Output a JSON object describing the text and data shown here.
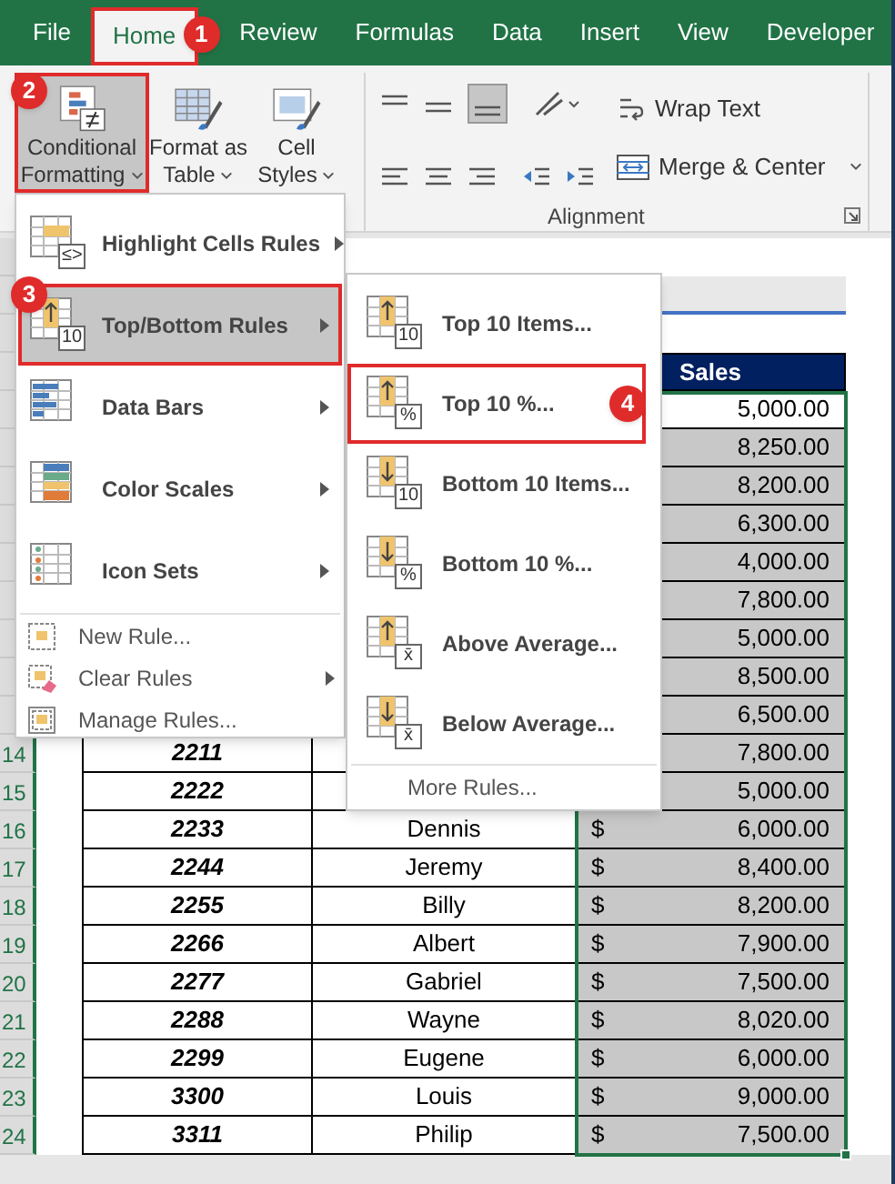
{
  "tabs": [
    {
      "label": "File",
      "selected": false
    },
    {
      "label": "Home",
      "selected": true,
      "badge": "1"
    },
    {
      "label": "Review",
      "selected": false
    },
    {
      "label": "Formulas",
      "selected": false
    },
    {
      "label": "Data",
      "selected": false
    },
    {
      "label": "Insert",
      "selected": false
    },
    {
      "label": "View",
      "selected": false
    },
    {
      "label": "Developer",
      "selected": false
    }
  ],
  "ribbon": {
    "buttons": [
      {
        "kind": "conditional",
        "lines": [
          "Conditional",
          "Formatting"
        ],
        "selected": true,
        "badge": "2"
      },
      {
        "kind": "table",
        "lines": [
          "Format as",
          "Table"
        ],
        "selected": false
      },
      {
        "kind": "styles",
        "lines": [
          "Cell",
          "Styles"
        ],
        "selected": false
      }
    ],
    "alignment": {
      "wrap_text": "Wrap Text",
      "merge": "Merge & Center",
      "label": "Alignment"
    }
  },
  "sheet": {
    "header": "Sales",
    "rows": [
      {
        "amount": "5,000.00",
        "active": true
      },
      {
        "amount": "8,250.00",
        "active": false
      },
      {
        "amount": "8,200.00",
        "active": false
      },
      {
        "amount": "6,300.00",
        "active": false
      },
      {
        "amount": "4,000.00",
        "active": false
      },
      {
        "amount": "7,800.00",
        "active": false
      },
      {
        "amount": "5,000.00",
        "active": false
      },
      {
        "amount": "8,500.00",
        "active": false
      },
      {
        "amount": "6,500.00",
        "active": false
      },
      {
        "row": "14",
        "id": "2211",
        "amount": "7,800.00",
        "active": false
      },
      {
        "row": "15",
        "id": "2222",
        "amount": "5,000.00",
        "active": false
      },
      {
        "row": "16",
        "id": "2233",
        "name": "Dennis",
        "currency": "$",
        "amount": "6,000.00",
        "active": false
      },
      {
        "row": "17",
        "id": "2244",
        "name": "Jeremy",
        "currency": "$",
        "amount": "8,400.00",
        "active": false
      },
      {
        "row": "18",
        "id": "2255",
        "name": "Billy",
        "currency": "$",
        "amount": "8,200.00",
        "active": false
      },
      {
        "row": "19",
        "id": "2266",
        "name": "Albert",
        "currency": "$",
        "amount": "7,900.00",
        "active": false
      },
      {
        "row": "20",
        "id": "2277",
        "name": "Gabriel",
        "currency": "$",
        "amount": "7,500.00",
        "active": false
      },
      {
        "row": "21",
        "id": "2288",
        "name": "Wayne",
        "currency": "$",
        "amount": "8,020.00",
        "active": false
      },
      {
        "row": "22",
        "id": "2299",
        "name": "Eugene",
        "currency": "$",
        "amount": "6,000.00",
        "active": false
      },
      {
        "row": "23",
        "id": "3300",
        "name": "Louis",
        "currency": "$",
        "amount": "9,000.00",
        "active": false
      },
      {
        "row": "24",
        "id": "3311",
        "name": "Philip",
        "currency": "$",
        "amount": "7,500.00",
        "active": false
      }
    ]
  },
  "menu": {
    "items": [
      {
        "kind": "highlight",
        "label": "Highlight Cells Rules",
        "icon_label": "≤>",
        "has_submenu": true,
        "selected": false
      },
      {
        "kind": "topbottom",
        "label": "Top/Bottom Rules",
        "icon_label": "10",
        "has_submenu": true,
        "selected": true,
        "badge": "3"
      },
      {
        "kind": "databars",
        "label": "Data Bars",
        "has_submenu": true,
        "selected": false
      },
      {
        "kind": "colorscales",
        "label": "Color Scales",
        "has_submenu": true,
        "selected": false
      },
      {
        "kind": "iconsets",
        "label": "Icon Sets",
        "has_submenu": true,
        "selected": false
      }
    ],
    "small_items": [
      {
        "kind": "newrule",
        "label": "New Rule...",
        "has_submenu": false
      },
      {
        "kind": "clearrules",
        "label": "Clear Rules",
        "has_submenu": true
      },
      {
        "kind": "managerules",
        "label": "Manage Rules...",
        "has_submenu": false
      }
    ]
  },
  "submenu": {
    "items": [
      {
        "kind": "top",
        "label": "Top 10 Items...",
        "icon_label": "10",
        "selected": false
      },
      {
        "kind": "top",
        "label": "Top 10 %...",
        "icon_label": "%",
        "selected": true,
        "badge": "4"
      },
      {
        "kind": "bottom",
        "label": "Bottom 10 Items...",
        "icon_label": "10",
        "selected": false
      },
      {
        "kind": "bottom",
        "label": "Bottom 10 %...",
        "icon_label": "%",
        "selected": false
      },
      {
        "kind": "top",
        "label": "Above Average...",
        "icon_label": "x̄",
        "selected": false
      },
      {
        "kind": "bottom",
        "label": "Below Average...",
        "icon_label": "x̄",
        "selected": false
      }
    ],
    "more": "More Rules..."
  }
}
